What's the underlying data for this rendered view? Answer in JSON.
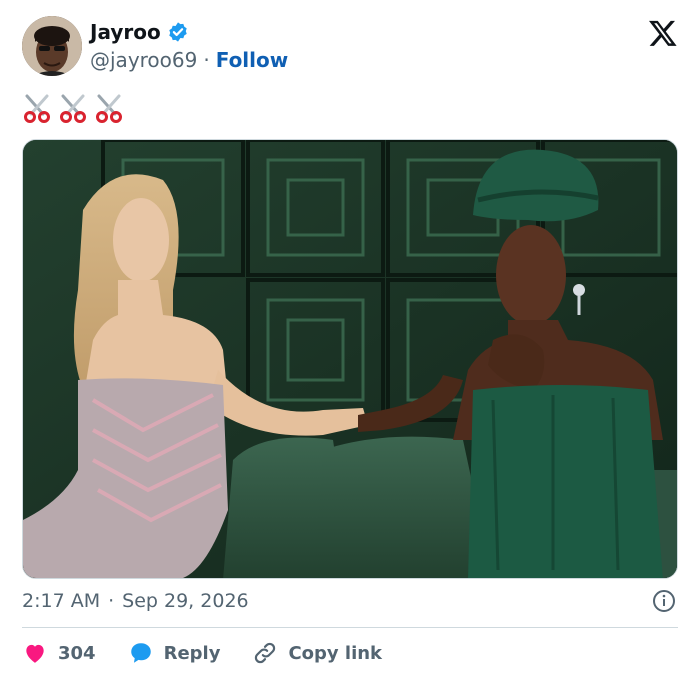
{
  "author": {
    "name": "Jayroo",
    "handle": "@jayroo69",
    "separator": "·",
    "follow_label": "Follow",
    "verified": true,
    "avatar_icon": "profile-photo",
    "accent_color": "#1d9bf0"
  },
  "tweet": {
    "text": "✂️✂️✂️",
    "emoji_icons": [
      "scissors-icon",
      "scissors-icon",
      "scissors-icon"
    ]
  },
  "media": {
    "type": "photo",
    "subject_icon": "photo"
  },
  "meta": {
    "time": "2:17 AM",
    "separator": "·",
    "date": "Sep 29, 2026",
    "info_icon": "info-icon"
  },
  "actions": {
    "like_count": "304",
    "like_color": "#f91880",
    "reply_label": "Reply",
    "reply_color": "#1d9bf0",
    "copy_label": "Copy link"
  },
  "brand": {
    "logo": "x-logo"
  }
}
